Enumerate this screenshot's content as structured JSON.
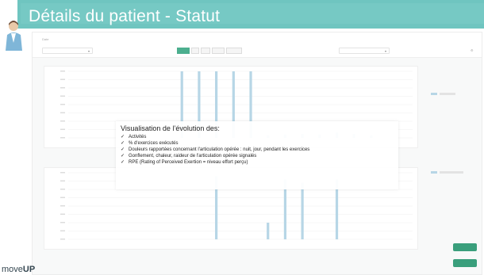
{
  "slide": {
    "title": "Détails du patient - Statut",
    "logo_prefix": "move",
    "logo_bold": "UP"
  },
  "overlay": {
    "heading": "Visualisation de l’évolution des:",
    "check_glyph": "✓",
    "items": [
      "Activités",
      "% d'exercices exécutés",
      "Douleurs rapportées concernant l'articulation opérée : nuit, jour, pendant les exercices",
      "Gonflement, chaleur, raideur de l'articulation opérée signalés",
      "RPE (Rating of Perceived Exertion = niveau effort perçu)"
    ]
  },
  "colors": {
    "header": "#76c9c4",
    "accent": "#3a9f7c",
    "bar": "#b7d6e6"
  },
  "chart_data": [
    {
      "type": "bar",
      "series": [
        {
          "values": [
            1.0,
            1.0,
            1.0,
            1.0,
            1.0,
            0.04,
            0.05,
            0.06,
            0.05,
            0.08,
            0.06,
            0.04
          ]
        }
      ],
      "ylim": [
        0,
        1
      ]
    },
    {
      "type": "bar",
      "series": [
        {
          "values": [
            0.0,
            0.0,
            0.95,
            0.0,
            0.0,
            0.25,
            0.9,
            0.85,
            0.0,
            0.9,
            0.0,
            0.0
          ]
        }
      ],
      "ylim": [
        0,
        1
      ]
    }
  ]
}
